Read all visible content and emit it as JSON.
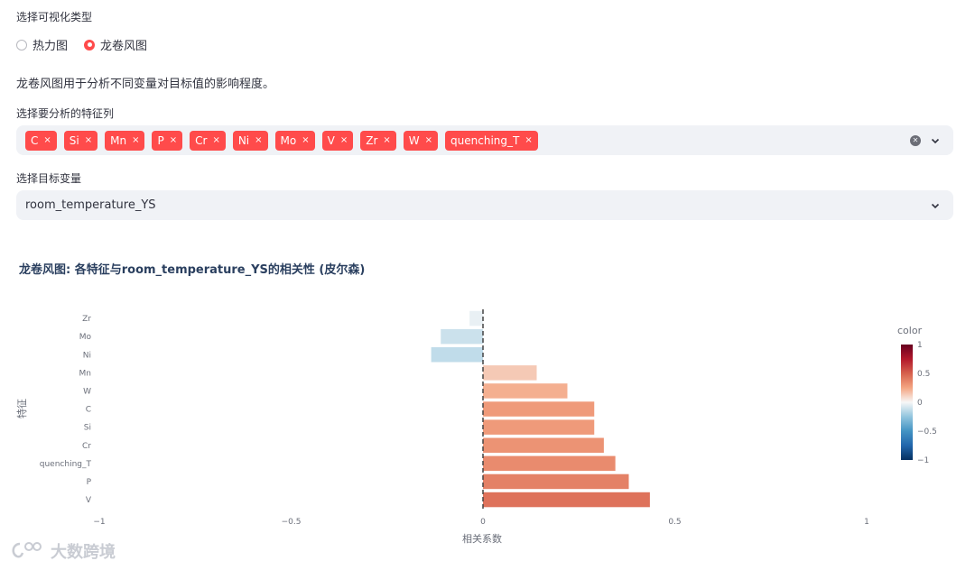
{
  "viz_type": {
    "label": "选择可视化类型",
    "options": [
      "热力图",
      "龙卷风图"
    ],
    "selected_index": 1
  },
  "description": "龙卷风图用于分析不同变量对目标值的影响程度。",
  "features": {
    "label": "选择要分析的特征列",
    "selected": [
      "C",
      "Si",
      "Mn",
      "P",
      "Cr",
      "Ni",
      "Mo",
      "V",
      "Zr",
      "W",
      "quenching_T"
    ],
    "remove_glyph": "×"
  },
  "target": {
    "label": "选择目标变量",
    "value": "room_temperature_YS"
  },
  "chart_data": {
    "type": "bar",
    "orientation": "horizontal",
    "title": "龙卷风图: 各特征与room_temperature_YS的相关性 (皮尔森)",
    "xlabel": "相关系数",
    "ylabel": "特征",
    "xlim": [
      -1,
      1
    ],
    "x_ticks": [
      -1,
      -0.5,
      0,
      0.5,
      1
    ],
    "x_tick_labels": [
      "−1",
      "−0.5",
      "0",
      "0.5",
      "1"
    ],
    "categories": [
      "Zr",
      "Mo",
      "Ni",
      "Mn",
      "W",
      "C",
      "Si",
      "Cr",
      "quenching_T",
      "P",
      "V"
    ],
    "values": [
      -0.035,
      -0.11,
      -0.135,
      0.14,
      0.22,
      0.29,
      0.29,
      0.315,
      0.345,
      0.38,
      0.435
    ],
    "colorscale": "RdBu_r",
    "colorbar": {
      "title": "color",
      "range": [
        -1,
        1
      ],
      "ticks": [
        1,
        0.5,
        0,
        -0.5,
        -1
      ],
      "tick_labels": [
        "1",
        "0.5",
        "0",
        "−0.5",
        "−1"
      ]
    },
    "zero_line": "dashed"
  },
  "watermark": "大数跨境",
  "colors": {
    "accent": "#ff4b4b",
    "input_bg": "#f0f2f6"
  }
}
